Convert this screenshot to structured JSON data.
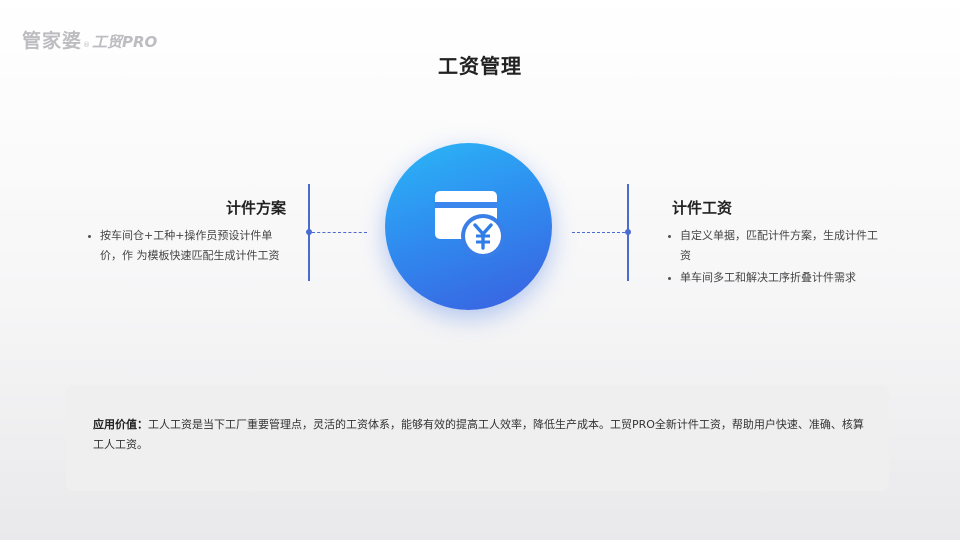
{
  "logo": {
    "brand": "管家婆",
    "reg": "®",
    "product": "工贸PRO"
  },
  "title": "工资管理",
  "left": {
    "heading": "计件方案",
    "bullets": [
      "按车间仓+工种+操作员预设计件单价，作 为模板快速匹配生成计件工资"
    ]
  },
  "right": {
    "heading": "计件工资",
    "bullets": [
      "自定义单据，匹配计件方案，生成计件工资",
      "单车间多工和解决工序折叠计件需求"
    ]
  },
  "center_icon": "wallet-yuan-icon",
  "value": {
    "label": "应用价值：",
    "text": "工人工资是当下工厂重要管理点，灵活的工资体系，能够有效的提高工人效率，降低生产成本。工贸PRO全新计件工资，帮助用户快速、准确、核算工人工资。"
  },
  "colors": {
    "accent": "#4a6bd0",
    "circle_start": "#2ab7f6",
    "circle_end": "#3a5fe0"
  }
}
